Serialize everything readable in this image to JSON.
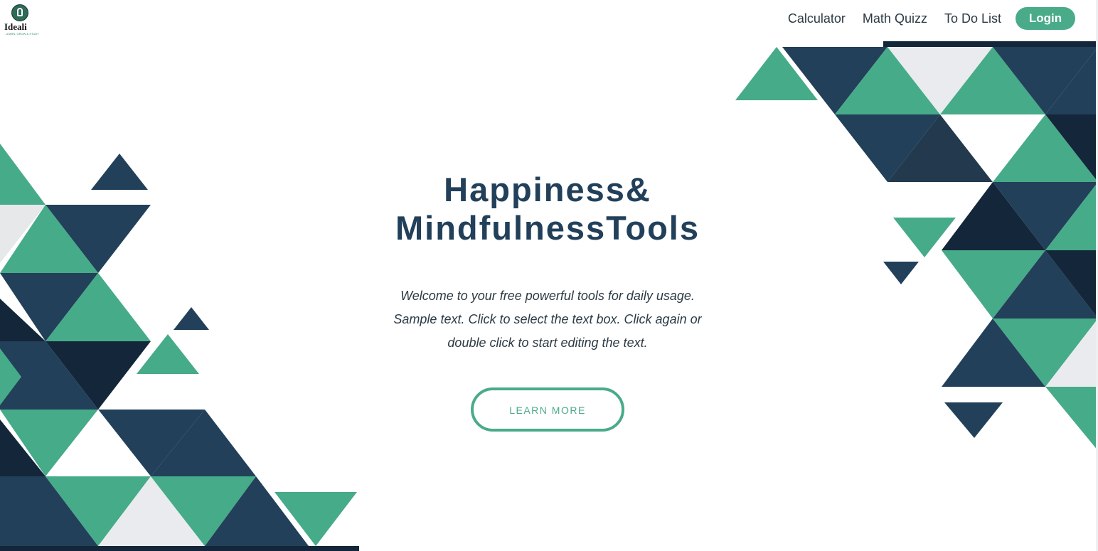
{
  "brand": {
    "name": "Ideali",
    "tagline": "LEARN, GROW & STUDY"
  },
  "nav": {
    "items": [
      {
        "label": "Calculator"
      },
      {
        "label": "Math Quizz"
      },
      {
        "label": "To Do List"
      }
    ],
    "login_label": "Login"
  },
  "hero": {
    "title_line1": "Happiness&",
    "title_line2": "MindfulnessTools",
    "body_line1": "Welcome to your free powerful tools for daily usage.",
    "body_line2": "Sample text. Click to select the text box. Click again or",
    "body_line3": "double click to start editing the text.",
    "cta_label": "LEARN MORE"
  },
  "colors": {
    "teal": "#4aab89",
    "navy": "#22405a",
    "dark_navy": "#13263a"
  }
}
